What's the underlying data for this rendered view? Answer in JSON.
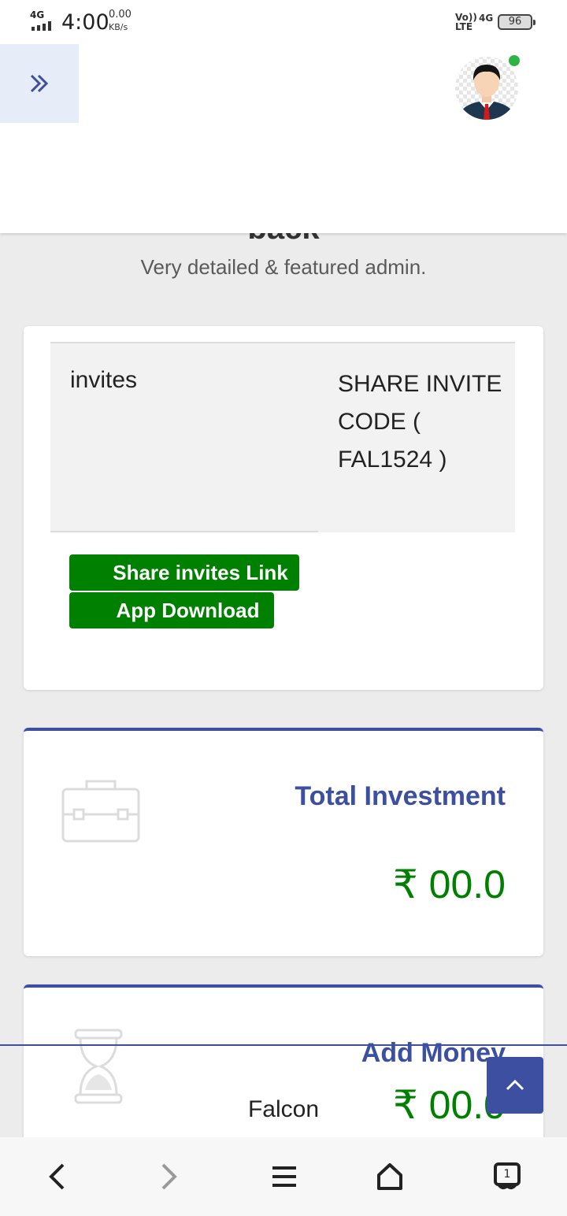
{
  "status_bar": {
    "network": "4G",
    "time": "4:00",
    "speed": "0.00",
    "speed_unit": "KB/s",
    "volte": "Vo)) LTE",
    "network2": "4G",
    "battery": "96"
  },
  "header": {
    "menu_icon": "double-chevron-right-icon",
    "avatar_alt": "user avatar",
    "online": true
  },
  "welcome": {
    "heading": "back",
    "subtitle": "Very detailed & featured admin."
  },
  "invite": {
    "left_label": "invites",
    "right_label": "SHARE INVITE CODE ( FAL1524 )",
    "share_button": "Share invites Link",
    "download_button": "App Download"
  },
  "stats": {
    "investment": {
      "title": "Total Investment",
      "value": "₹ 00.0",
      "icon": "briefcase-icon"
    },
    "add_money": {
      "title": "Add Money",
      "value": "₹ 00.0",
      "icon": "hourglass-icon"
    }
  },
  "footer": {
    "text": "Falcon"
  },
  "colors": {
    "brand": "#3d4fa0",
    "green": "#008000",
    "background": "#ececec"
  },
  "navbar": [
    "back-icon",
    "forward-icon",
    "menu-icon",
    "home-icon",
    "tabs-icon"
  ],
  "navbar_tabs_count": "1"
}
